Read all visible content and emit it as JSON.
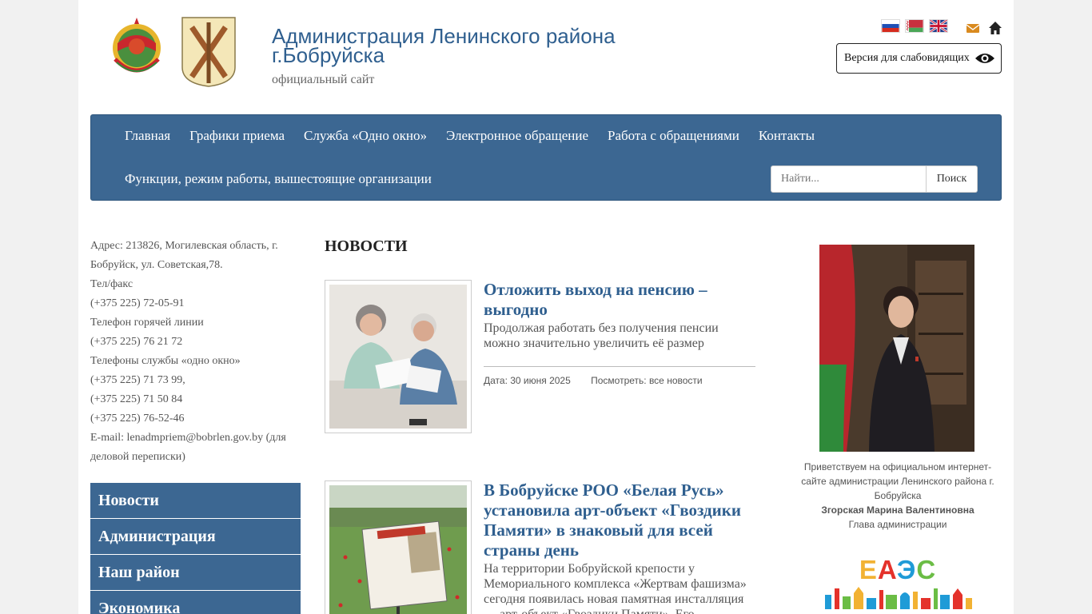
{
  "header": {
    "title": "Администрация Ленинского района г.Бобруйска",
    "subtitle": "официальный сайт",
    "low_vision_label": "Версия для слабовидящих",
    "languages": [
      "ru",
      "by",
      "en"
    ]
  },
  "nav": {
    "row1": [
      "Главная",
      "Графики приема",
      "Служба «Одно окно»",
      "Электронное обращение",
      "Работа с обращениями",
      "Контакты"
    ],
    "row2": [
      "Функции, режим работы, вышестоящие организации"
    ],
    "search_placeholder": "Найти...",
    "search_button": "Поиск"
  },
  "contacts": {
    "lines": [
      "Адрес: 213826, Могилевская область, г. Бобруйск, ул. Советская,78.",
      "Тел/факс",
      "(+375 225) 72-05-91",
      "Телефон горячей линии",
      "(+375 225) 76 21 72",
      "Телефоны службы «одно окно»",
      "(+375 225) 71 73 99,",
      "(+375 225) 71 50 84",
      "(+375 225) 76-52-46",
      "E-mail: lenadmpriem@bobrlen.gov.by (для деловой переписки)"
    ]
  },
  "side_menu": [
    "Новости",
    "Администрация",
    "Наш район",
    "Экономика"
  ],
  "news": {
    "heading": "НОВОСТИ",
    "items": [
      {
        "title": "Отложить выход на пенсию – выгодно",
        "text": "Продолжая работать без получения пенсии можно значительно увеличить её размер",
        "date": "Дата: 30 июня 2025",
        "all_news": "Посмотреть: все новости"
      },
      {
        "title": "В Бобруйске РОО «Белая Русь» установила арт-объект «Гвоздики Памяти» в знаковый для всей страны день",
        "text": "На территории Бобруйской крепости у Мемориального комплекса «Жертвам фашизма» сегодня появилась новая памятная инсталляция — арт-объект «Гвоздики Памяти». Его"
      }
    ]
  },
  "head_of_admin": {
    "greeting": "Приветствуем на официальном интернет-сайте администрации Ленинского района г. Бобруйска",
    "name": "Згорская Марина Валентиновна",
    "position": "Глава администрации"
  },
  "banner": {
    "eaes_text": "ЕАЭС",
    "colors": [
      "#f2b233",
      "#e4322b",
      "#1f9bd7",
      "#6bbd45"
    ]
  },
  "colors": {
    "nav_blue": "#3c6792",
    "link_blue": "#2f5f8f"
  }
}
